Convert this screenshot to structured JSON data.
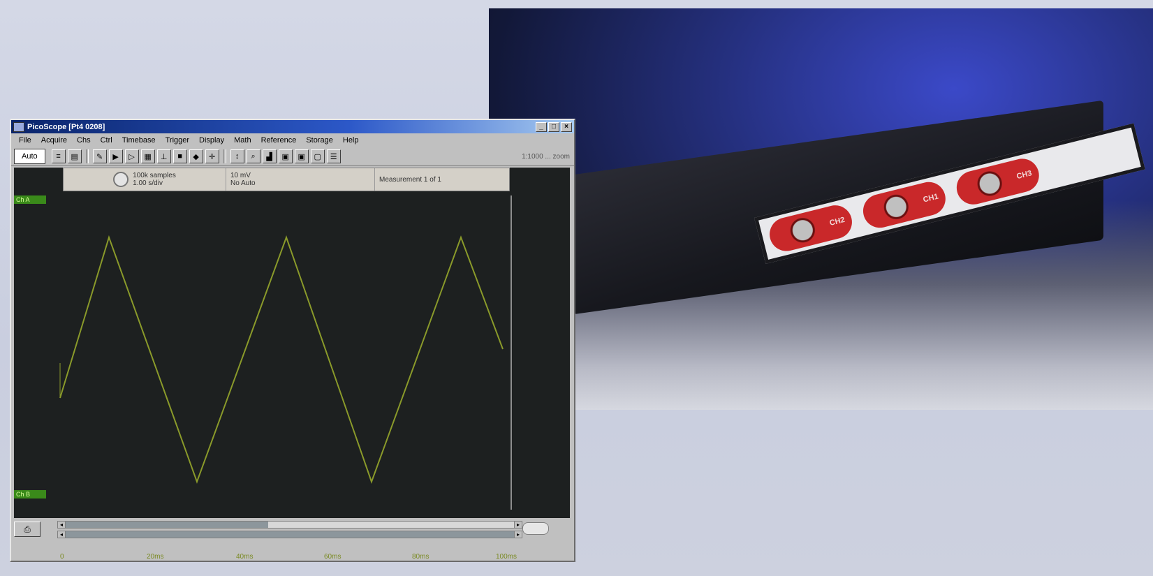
{
  "window": {
    "title": "PicoScope [Pt4 0208]",
    "controls": [
      "_",
      "□",
      "×"
    ]
  },
  "menubar": {
    "items": [
      "File",
      "Acquire",
      "Chs",
      "Ctrl",
      "Timebase",
      "Trigger",
      "Display",
      "Math",
      "Reference",
      "Storage",
      "Help"
    ]
  },
  "toolbar": {
    "auto_label": "Auto",
    "status_text": "1:1000 ... zoom"
  },
  "info_panel": {
    "line1": "100k samples",
    "line2": "1.00 s/div",
    "line3": "10 mV",
    "line4": "No Auto",
    "line5": "Measurement 1 of 1"
  },
  "scope": {
    "top_tag": "Ch A",
    "bottom_tag": "Ch B",
    "trace_color": "#8a9a2a",
    "background_color": "#1d2020",
    "x_ticks": [
      "0",
      "20ms",
      "40ms",
      "60ms",
      "80ms",
      "100ms"
    ]
  },
  "scrollbars": {
    "top_position": 0.45,
    "bottom_position": 1.0
  },
  "photo": {
    "connector_labels": [
      "CH2",
      "CH1",
      "CH3"
    ]
  }
}
